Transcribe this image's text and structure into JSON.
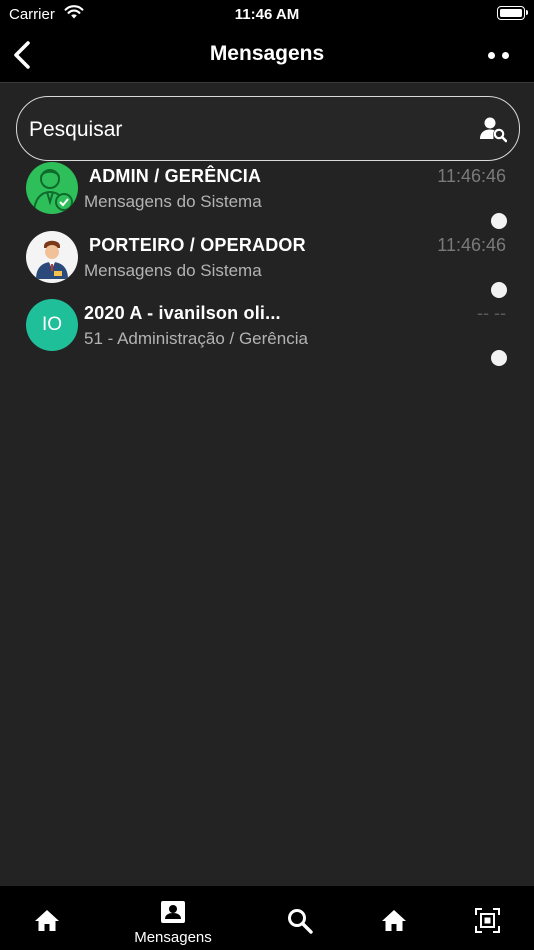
{
  "status_bar": {
    "carrier": "Carrier",
    "time": "11:46 AM"
  },
  "nav": {
    "title": "Mensagens"
  },
  "search": {
    "placeholder": "Pesquisar"
  },
  "conversations": [
    {
      "name": "ADMIN / GERÊNCIA",
      "subtitle": "Mensagens do Sistema",
      "time": "11:46:46",
      "avatar": "admin-avatar"
    },
    {
      "name": "PORTEIRO / OPERADOR",
      "subtitle": "Mensagens do Sistema",
      "time": "11:46:46",
      "avatar": "porter-avatar"
    },
    {
      "name": "2020 A - ivanilson oli...",
      "subtitle": "51 - Administração / Gerência",
      "time": "-- --",
      "avatar_initials": "IO"
    }
  ],
  "tabbar": {
    "items": [
      {
        "icon": "home-icon"
      },
      {
        "icon": "contact-card-icon",
        "label": "Mensagens"
      },
      {
        "icon": "search-icon"
      },
      {
        "icon": "home-icon"
      },
      {
        "icon": "qr-scan-icon"
      }
    ]
  },
  "colors": {
    "background": "#232323",
    "bar": "#000000",
    "initials_avatar": "#1fbf9a",
    "admin_avatar": "#2fbf5a"
  }
}
